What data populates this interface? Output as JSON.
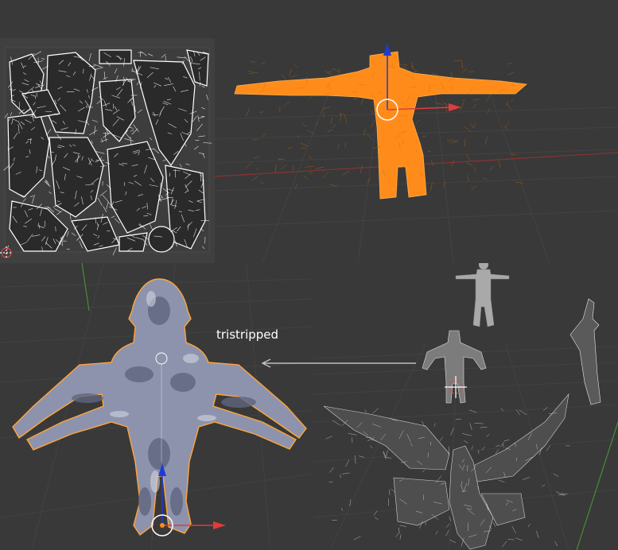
{
  "screenshot": {
    "annotation_label": "tristripped"
  },
  "colors": {
    "viewport_background": "#393939",
    "uv_editor_background": "#404040",
    "uv_wire": "#ffffff",
    "grid_line": "#474747",
    "selected_mesh": "#ff8c1a",
    "selection_outline": "#ffa53a",
    "x_axis": "#e23b3b",
    "y_axis": "#66c23a",
    "z_axis": "#1d3bd6",
    "arrow_annotation": "#d8d8d8",
    "mesh_gray": "#a9a9a9",
    "textured_mesh": "#8f95ad"
  },
  "panels": {
    "uv_editor": "uv-layout-wireframe",
    "orange_viewport": "selected-humanoid-wireframe",
    "textured_viewport": "textured-creature-selected",
    "scene_viewport": "multiple-models-scene"
  },
  "icons": {
    "transform_gizmo": "move-manipulator-icon",
    "cursor_3d": "3d-cursor-icon",
    "annotation_arrow": "left-arrow"
  }
}
